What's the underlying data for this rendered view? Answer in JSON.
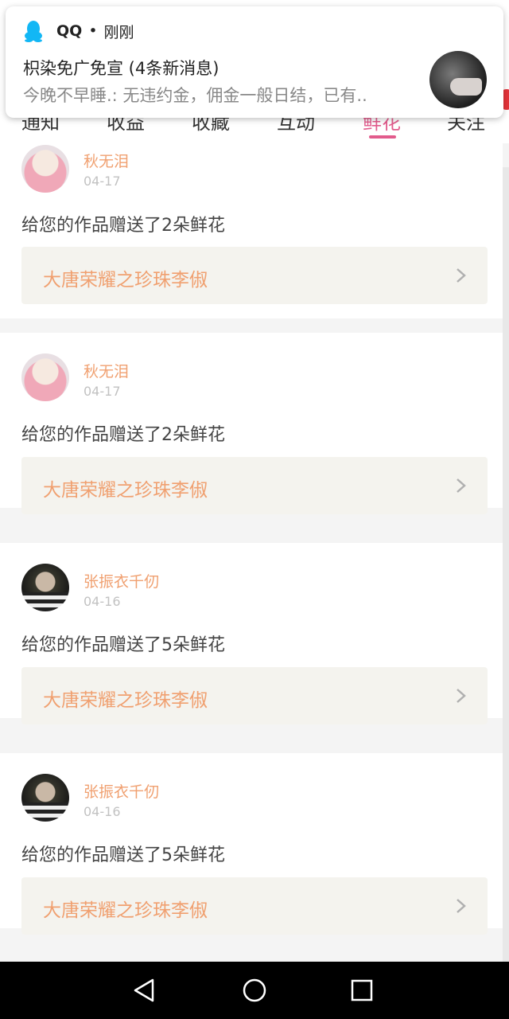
{
  "tabs": [
    {
      "label": "通知"
    },
    {
      "label": "收益"
    },
    {
      "label": "收藏"
    },
    {
      "label": "互动"
    },
    {
      "label": "鲜花",
      "active": true
    },
    {
      "label": "关注"
    }
  ],
  "notification": {
    "app_name": "QQ",
    "separator": "•",
    "time": "刚刚",
    "title": "枳染免广免宣 (4条新消息)",
    "body": "今晚不早睡.: 无违约金，佣金一般日结，已有..",
    "icon": "qq-penguin-icon"
  },
  "cards": [
    {
      "user": "秋无泪",
      "date": "04-17",
      "message": "给您的作品赠送了2朵鲜花",
      "work": "大唐荣耀之珍珠李俶",
      "avatar": "anime"
    },
    {
      "user": "秋无泪",
      "date": "04-17",
      "message": "给您的作品赠送了2朵鲜花",
      "work": "大唐荣耀之珍珠李俶",
      "avatar": "anime"
    },
    {
      "user": "张振衣千仞",
      "date": "04-16",
      "message": "给您的作品赠送了5朵鲜花",
      "work": "大唐荣耀之珍珠李俶",
      "avatar": "photo"
    },
    {
      "user": "张振衣千仞",
      "date": "04-16",
      "message": "给您的作品赠送了5朵鲜花",
      "work": "大唐荣耀之珍珠李俶",
      "avatar": "photo"
    }
  ],
  "colors": {
    "accent_pink": "#e25b8c",
    "name_orange": "#f0a070",
    "work_bg": "#f4f3ee"
  },
  "nav": {
    "back_icon": "back-triangle-icon",
    "home_icon": "home-circle-icon",
    "recents_icon": "recents-square-icon"
  }
}
